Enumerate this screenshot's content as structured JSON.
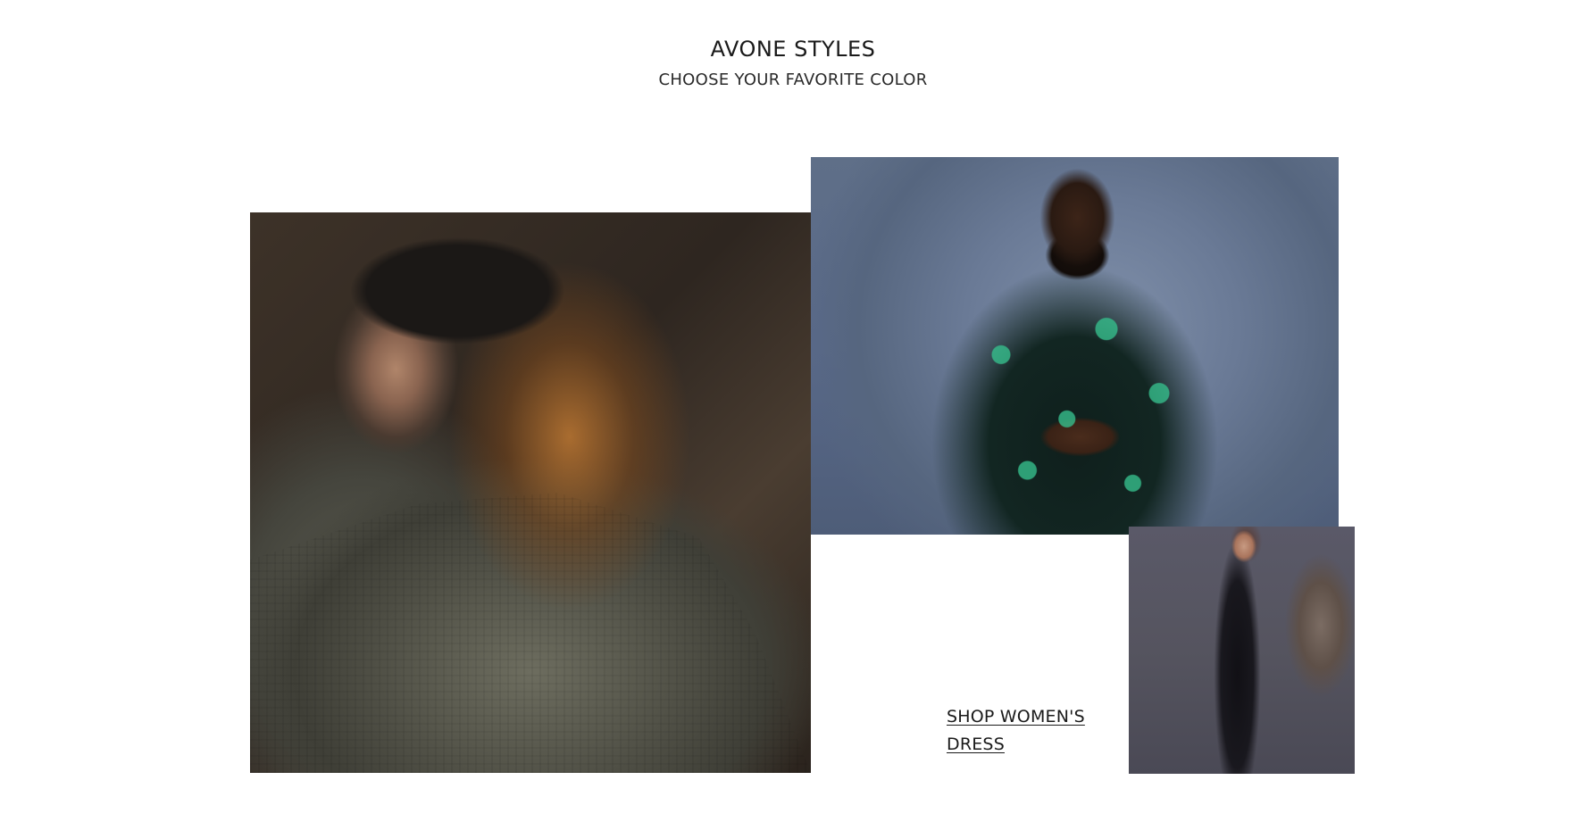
{
  "header": {
    "title": "AVONE STYLES",
    "subtitle": "CHOOSE YOUR FAVORITE COLOR"
  },
  "gallery": {
    "shop_link_label": "SHOP WOMEN'S DRESS",
    "images": [
      {
        "name": "woman-in-cap-photo"
      },
      {
        "name": "man-in-patterned-shirt-photo"
      },
      {
        "name": "woman-in-sequin-dress-photo"
      }
    ]
  }
}
